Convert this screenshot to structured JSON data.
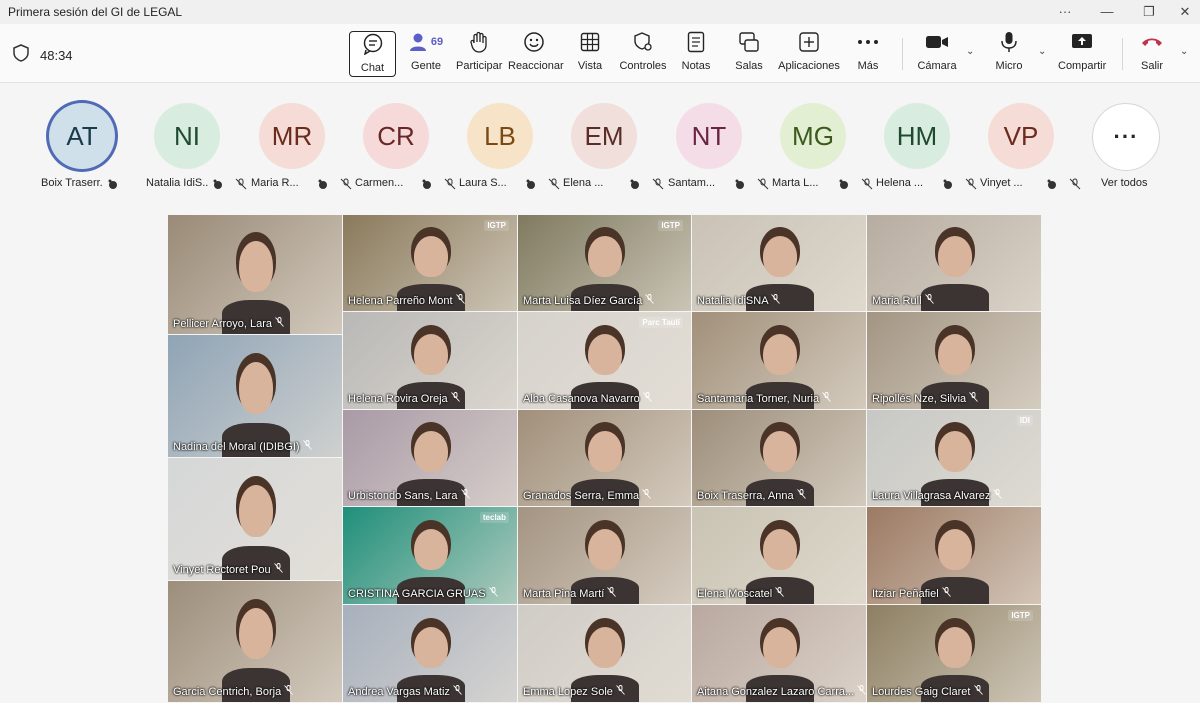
{
  "window": {
    "title": "Primera sesión del GI de LEGAL"
  },
  "meeting": {
    "timer": "48:34"
  },
  "toolbar": {
    "chat": "Chat",
    "people": "Gente",
    "people_count": "69",
    "raise": "Participar",
    "react": "Reaccionar",
    "view": "Vista",
    "controls": "Controles",
    "notes": "Notas",
    "rooms": "Salas",
    "apps": "Aplicaciones",
    "more": "Más",
    "camera": "Cámara",
    "mic": "Micro",
    "share": "Compartir",
    "leave": "Salir"
  },
  "colors": {
    "leave_red": "#c4314b",
    "people_blue": "#5b5fc7",
    "active_ring": "#4f6bb5"
  },
  "strip": {
    "participants": [
      {
        "initials": "AT",
        "name": "Boix Traserr...",
        "bg": "#cfe0ea",
        "fg": "#1b3a4b"
      },
      {
        "initials": "NI",
        "name": "Natalia IdiS...",
        "bg": "#d9ece0",
        "fg": "#1e4a2f"
      },
      {
        "initials": "MR",
        "name": "Maria R...",
        "bg": "#f5dcd6",
        "fg": "#6b2b1d"
      },
      {
        "initials": "CR",
        "name": "Carmen...",
        "bg": "#f6dada",
        "fg": "#6a2626"
      },
      {
        "initials": "LB",
        "name": "Laura S...",
        "bg": "#f7e3c8",
        "fg": "#7a4a12"
      },
      {
        "initials": "EM",
        "name": "Elena ...",
        "bg": "#f1dfdc",
        "fg": "#5a2e28"
      },
      {
        "initials": "NT",
        "name": "Santam...",
        "bg": "#f4dde6",
        "fg": "#6a2540"
      },
      {
        "initials": "MG",
        "name": "Marta L...",
        "bg": "#e2efd3",
        "fg": "#3b5a1b"
      },
      {
        "initials": "HM",
        "name": "Helena ...",
        "bg": "#d9ece0",
        "fg": "#1e4a2f"
      },
      {
        "initials": "VP",
        "name": "Vinyet ...",
        "bg": "#f6dcd6",
        "fg": "#6b2b1d"
      }
    ],
    "see_all": "Ver todos",
    "see_all_glyph": "···"
  },
  "video": {
    "tiles": [
      {
        "name": "Pellicer Arroyo, Lara",
        "bg": "#9a8a77",
        "logo": ""
      },
      {
        "name": "Helena Parreño Mont",
        "bg": "#8a7a5c",
        "logo": "IGTP"
      },
      {
        "name": "Marta Luisa Díez García",
        "bg": "#7f7a5f",
        "logo": "IGTP"
      },
      {
        "name": "Natalia IdiSNA",
        "bg": "#c9c2b5",
        "logo": ""
      },
      {
        "name": "Maria Rull",
        "bg": "#b7aca0",
        "logo": ""
      },
      {
        "name": "Nadina del Moral (IDIBGI)",
        "bg": "#8fa4b6",
        "logo": ""
      },
      {
        "name": "Helena Rovira Oreja",
        "bg": "#b9b8b6",
        "logo": ""
      },
      {
        "name": "Alba Casanova Navarro",
        "bg": "#d6d2cc",
        "logo": "Parc Taulí"
      },
      {
        "name": "Santamaria Torner, Nuria",
        "bg": "#a1907a",
        "logo": ""
      },
      {
        "name": "Ripollés Nze, Silvia",
        "bg": "#a39583",
        "logo": ""
      },
      {
        "name": "Vinyet Rectoret Pou",
        "bg": "#d5d7d8",
        "logo": ""
      },
      {
        "name": "Urbistondo Sans, Lara",
        "bg": "#a99aa6",
        "logo": ""
      },
      {
        "name": "Granados Serra, Emma",
        "bg": "#a18f7a",
        "logo": ""
      },
      {
        "name": "Boix Traserra, Anna",
        "bg": "#9d8e7a",
        "logo": ""
      },
      {
        "name": "Laura Villagrasa Alvarez",
        "bg": "#c7c8c5",
        "logo": "IDI"
      },
      {
        "name": "CRISTINA GARCIA GRUAS",
        "bg": "#1f8f7a",
        "logo": "teclab"
      },
      {
        "name": "Marta Pina Martí",
        "bg": "#a49482",
        "logo": ""
      },
      {
        "name": "Elena Moscatel",
        "bg": "#c9c3b3",
        "logo": ""
      },
      {
        "name": "Itziar Peñafiel",
        "bg": "#9c7a63",
        "logo": ""
      },
      {
        "name": "Garcia Centrich, Borja",
        "bg": "#9d8e7b",
        "logo": ""
      },
      {
        "name": "Andrea Vargas Matiz",
        "bg": "#a7b0bd",
        "logo": ""
      },
      {
        "name": "Emma Lopez Sole",
        "bg": "#d0ccc6",
        "logo": ""
      },
      {
        "name": "Aitana Gonzalez Lazaro Carra...",
        "bg": "#b9a8a0",
        "logo": ""
      },
      {
        "name": "Lourdes Gaig Claret",
        "bg": "#8d7f62",
        "logo": "IGTP"
      }
    ]
  }
}
